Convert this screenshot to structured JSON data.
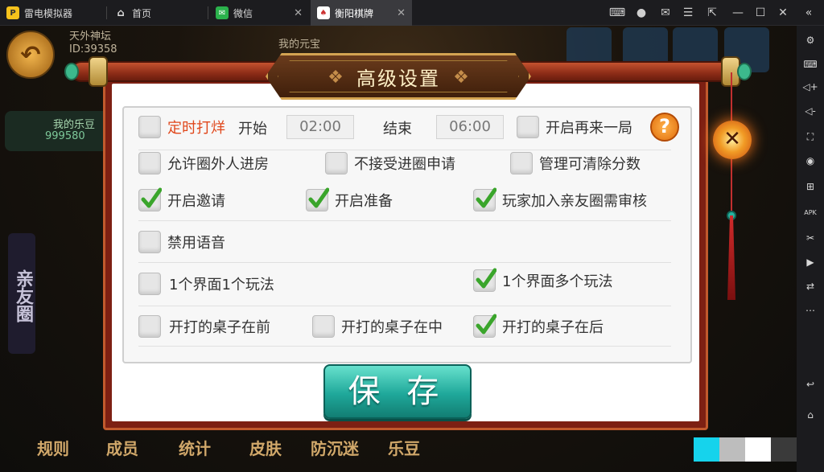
{
  "titlebar": {
    "app_name": "雷电模拟器",
    "tabs": [
      {
        "label": "首页",
        "active": false
      },
      {
        "label": "微信",
        "active": false
      },
      {
        "label": "衡阳棋牌",
        "active": true
      }
    ]
  },
  "background": {
    "player_name": "天外神坛",
    "player_id": "ID:39358",
    "my_pit": "我的元宝",
    "my_beans_label": "我的乐豆",
    "my_beans_value": "999580",
    "club_label": "亲友圈",
    "club_arrow": "»",
    "bottom_nav": [
      "规则",
      "成员",
      "统计",
      "皮肤",
      "防沉迷",
      "乐豆"
    ]
  },
  "dialog": {
    "title": "高级设置",
    "close_glyph": "✕",
    "help_glyph": "?",
    "save_label": "保 存",
    "timer": {
      "label": "定时打烊",
      "checked": false,
      "start_label": "开始",
      "start_value": "02:00",
      "end_label": "结束",
      "end_value": "06:00"
    },
    "options": {
      "replay": {
        "label": "开启再来一局",
        "checked": false
      },
      "allow_outsiders": {
        "label": "允许圈外人进房",
        "checked": false
      },
      "reject_join": {
        "label": "不接受进圈申请",
        "checked": false
      },
      "admin_clear_score": {
        "label": "管理可清除分数",
        "checked": false
      },
      "enable_invite": {
        "label": "开启邀请",
        "checked": true
      },
      "enable_ready": {
        "label": "开启准备",
        "checked": true
      },
      "join_review": {
        "label": "玩家加入亲友圈需审核",
        "checked": true
      },
      "disable_voice": {
        "label": "禁用语音",
        "checked": false
      },
      "one_per_screen": {
        "label": "1个界面1个玩法",
        "checked": false
      },
      "multi_per_screen": {
        "label": "1个界面多个玩法",
        "checked": true
      },
      "table_front": {
        "label": "开打的桌子在前",
        "checked": false
      },
      "table_middle": {
        "label": "开打的桌子在中",
        "checked": false
      },
      "table_back": {
        "label": "开打的桌子在后",
        "checked": true
      }
    }
  },
  "colors": {
    "accent_red": "#e0471b",
    "check_green": "#3aa52b",
    "save_teal": "#1fa89a"
  }
}
